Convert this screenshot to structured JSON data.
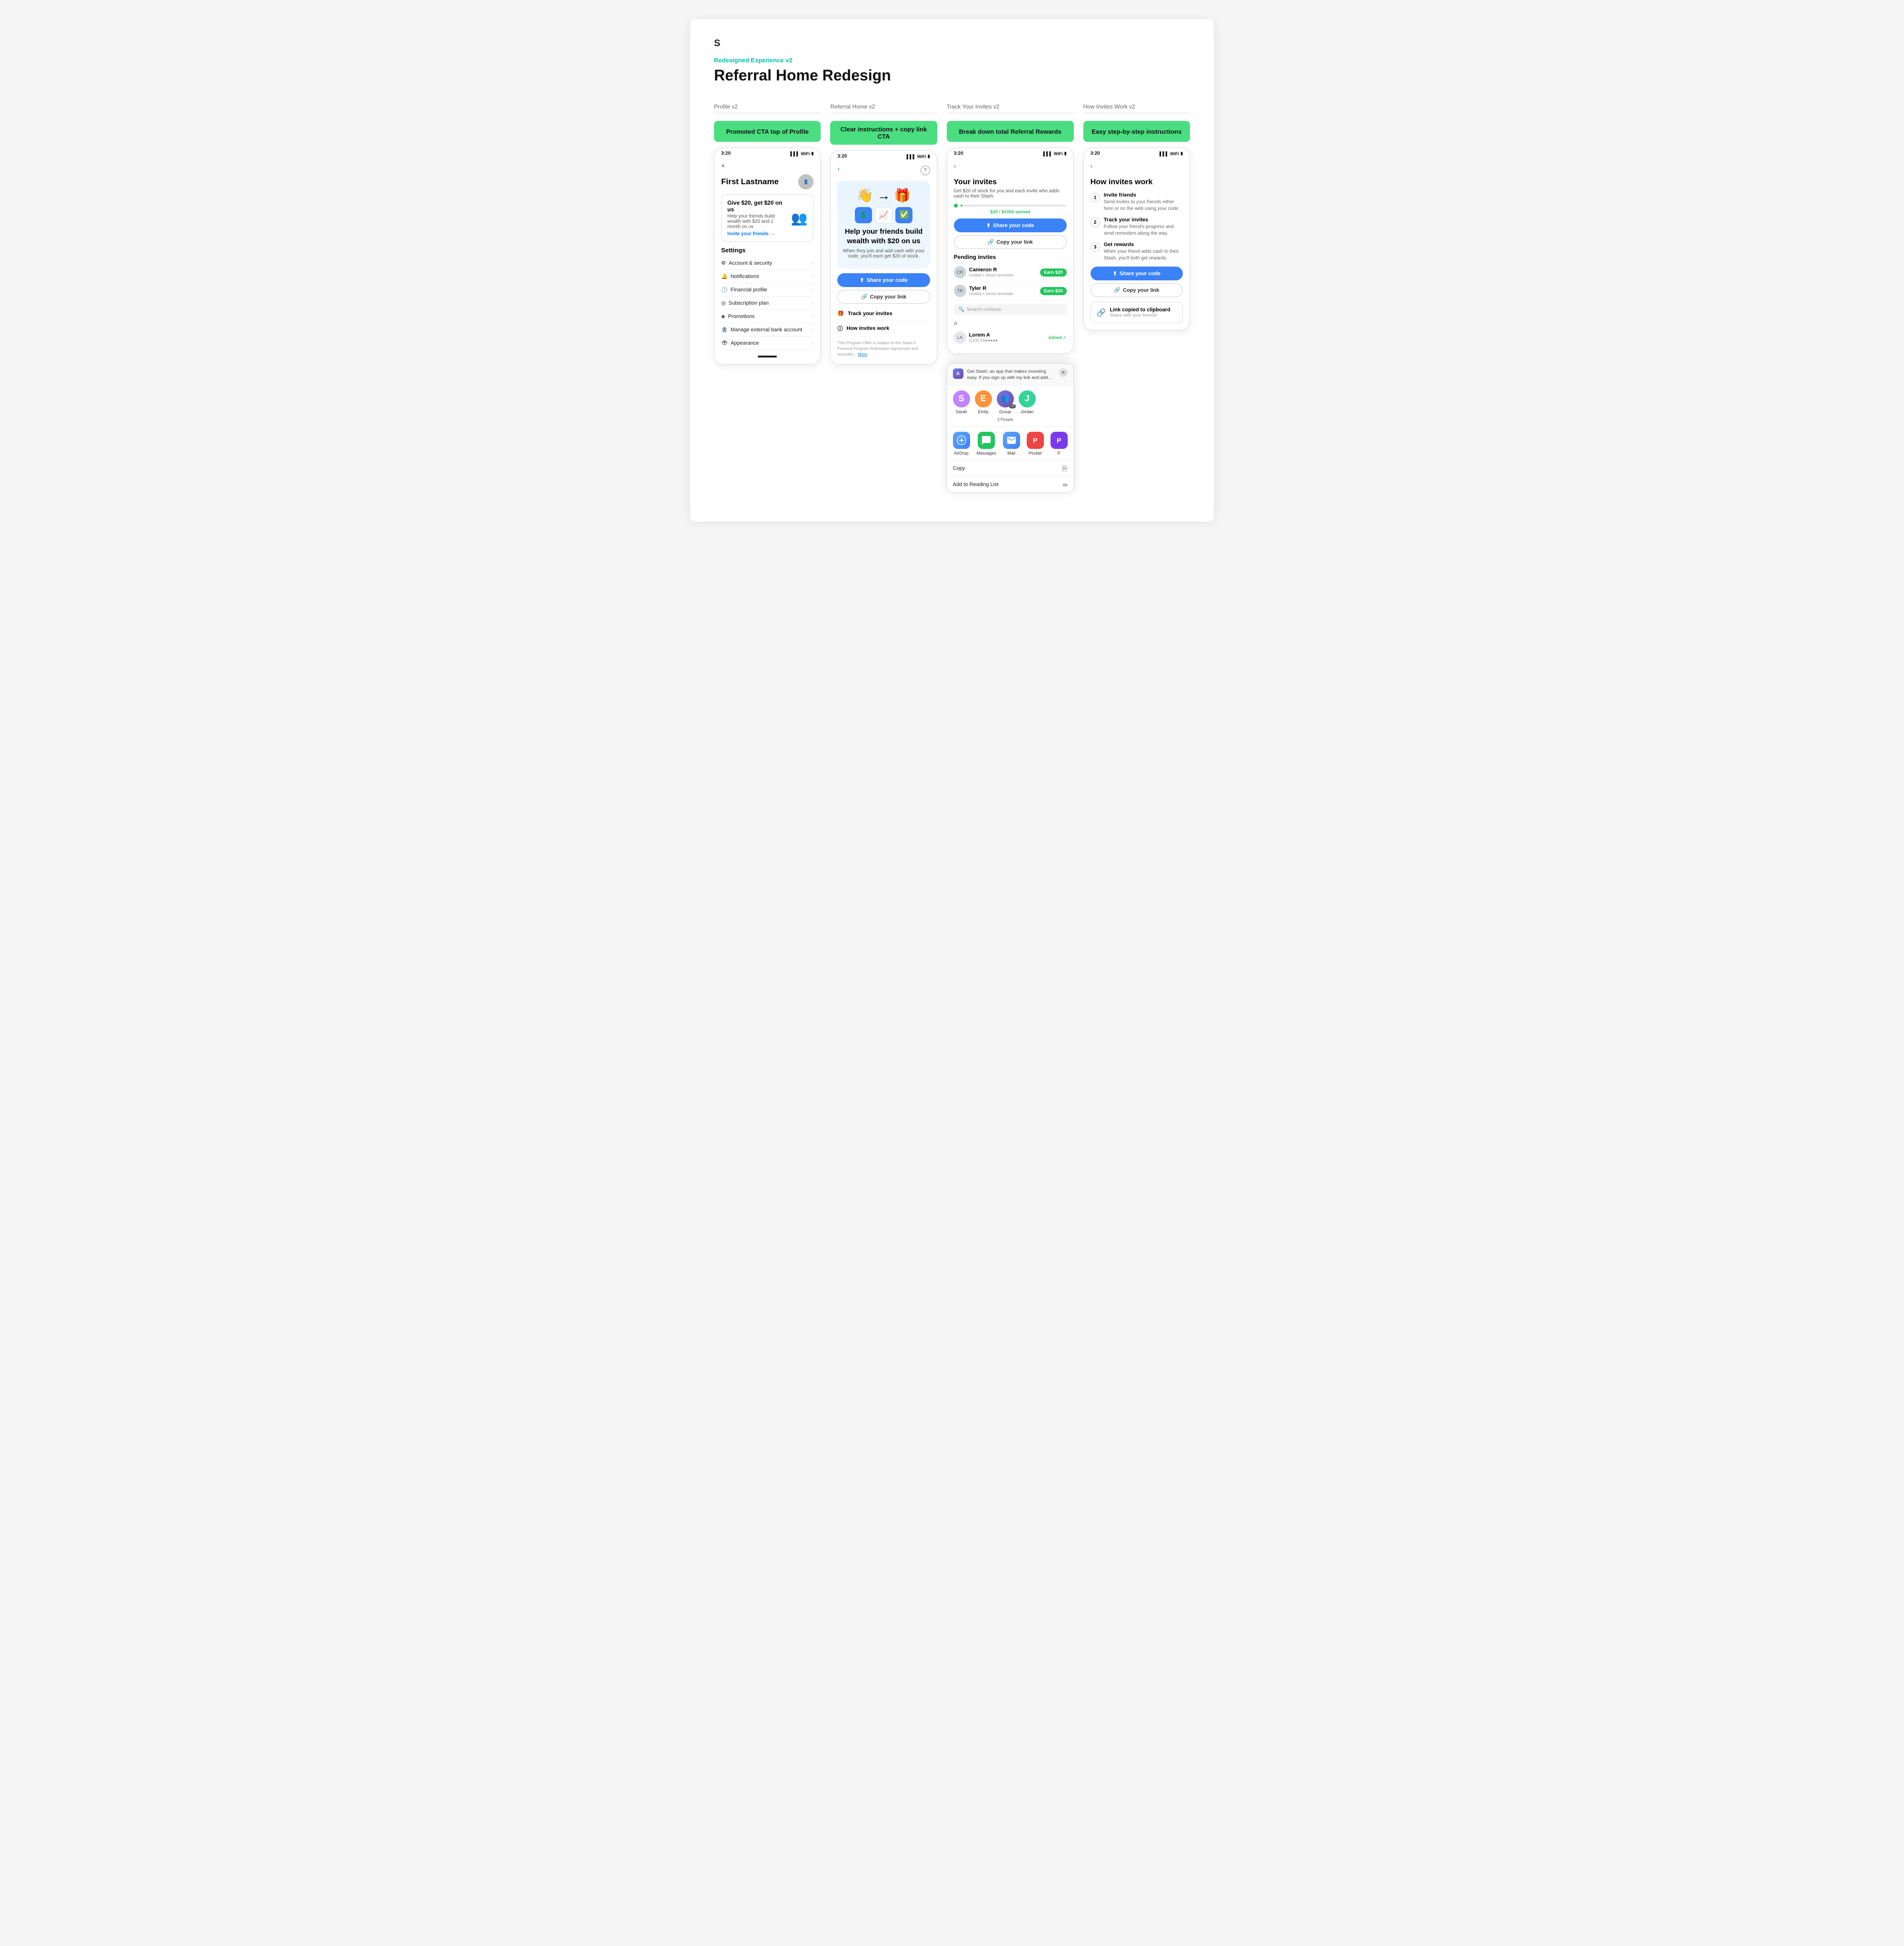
{
  "header": {
    "logo": "S",
    "subtitle": "Redesigned Experience v2",
    "title": "Referral Home Redesign"
  },
  "columns": [
    {
      "id": "profile",
      "label": "Profile v2",
      "pill": "Promoted CTA top of Profile",
      "phone": {
        "time": "3:20",
        "back": "×",
        "profile_name": "First Lastname",
        "cta_title": "Give $20, get $20 on us",
        "cta_desc": "Help your friends build wealth with $20 and 1 month on us",
        "cta_link": "Invite your friends →",
        "settings_header": "Settings",
        "settings_items": [
          "Account & security",
          "Notifications",
          "Financial profile",
          "Subscription plan",
          "Promotions",
          "Manage external bank account",
          "Appearance"
        ]
      }
    },
    {
      "id": "referral_home",
      "label": "Referral Home v2",
      "pill": "Clear instructions + copy link CTA",
      "phone": {
        "time": "3:20",
        "back": "‹",
        "help": "?",
        "heading": "Help your friends build wealth with $20 on us",
        "desc": "When they join and add cash with your code, you'll each get $20 of stock.",
        "btn_share": "Share your code",
        "btn_copy": "Copy your link",
        "menu_track": "Track your invites",
        "menu_how": "How invites work",
        "disclaimer": "This Program Offer is subject to the Stash it Forward Program Solicitation Agreement and excludes...",
        "disclaimer_link": "More"
      }
    },
    {
      "id": "track_invites",
      "label": "Track Your Invites v2",
      "pill": "Break down total Referral Rewards",
      "phone": {
        "time": "3:20",
        "back": "‹",
        "title": "Your invites",
        "desc": "Get $20 of stock for you and each invite who adds cash to their Stash.",
        "earnings": "$20",
        "earnings_total": "$1000 earned",
        "btn_share": "Share your code",
        "btn_copy": "Copy your link",
        "pending_header": "Pending invites",
        "invites": [
          {
            "name": "Cameron R",
            "status": "Invited • Send reminder",
            "badge": "Earn $20"
          },
          {
            "name": "Tyler R",
            "status": "Invited • Send reminder",
            "badge": "Earn $20"
          }
        ],
        "search_placeholder": "Search contacts",
        "section_letter": "A",
        "contact_name": "Lorem A",
        "contact_phone": "(123) 55●●●●●",
        "contact_status": "Joined ✓"
      }
    },
    {
      "id": "how_invites",
      "label": "How Invites Work v2",
      "pill": "Easy step-by-step instructions",
      "phone": {
        "time": "3:20",
        "back": "‹",
        "title": "How invites work",
        "steps": [
          {
            "num": "1",
            "title": "Invite friends",
            "desc": "Send invites to your friends either here or on the web using your code."
          },
          {
            "num": "2",
            "title": "Track your invites",
            "desc": "Follow your friend's progress and send reminders along the way."
          },
          {
            "num": "3",
            "title": "Get rewards",
            "desc": "When your friend adds cash to their Stash, you'll both get rewards."
          }
        ],
        "btn_share": "Share your code",
        "btn_copy": "Copy your link",
        "toast_title": "Link copied to clipboard",
        "toast_desc": "Share with your friends!"
      }
    }
  ],
  "share_sheet": {
    "app_initial": "A",
    "text": "Get Stash, an app that makes investing easy. If you sign up with my link and add...",
    "contacts": [
      {
        "name": "Sarah",
        "color": "#c084fc"
      },
      {
        "name": "Emily",
        "color": "#fb923c"
      },
      {
        "name": "Group",
        "count": "3 People",
        "color": "#818cf8"
      },
      {
        "name": "Jordan",
        "color": "#34d399"
      }
    ],
    "apps": [
      {
        "name": "AirDrop",
        "icon": "📡",
        "bg": "#3b82f6"
      },
      {
        "name": "Messages",
        "icon": "💬",
        "bg": "#22c55e"
      },
      {
        "name": "Mail",
        "icon": "✉️",
        "bg": "#3b82f6"
      },
      {
        "name": "Pocket",
        "icon": "🔴",
        "bg": "#ef4444"
      },
      {
        "name": "P",
        "icon": "P",
        "bg": "#7c3aed"
      }
    ],
    "actions": [
      {
        "label": "Copy",
        "icon": "⎘"
      },
      {
        "label": "Add to Reading List",
        "icon": "∞"
      }
    ]
  }
}
